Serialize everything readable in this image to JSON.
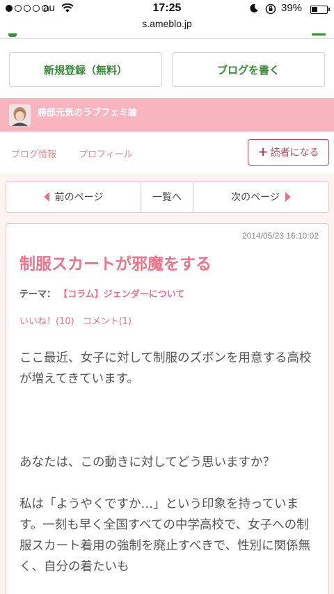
{
  "status_bar": {
    "carrier": "au",
    "time": "17:25",
    "battery_percent": "39%",
    "battery_level": 0.39
  },
  "browser": {
    "url": "s.ameblo.jp"
  },
  "top_buttons": {
    "register": "新規登録（無料）",
    "write_blog": "ブログを書く"
  },
  "blog": {
    "title": "勝部元気のラブフェミ論"
  },
  "nav": {
    "blog_info": "ブログ情報",
    "profile": "プロフィール",
    "reader_button": "読者になる"
  },
  "pager": {
    "prev": "前のページ",
    "list": "一覧へ",
    "next": "次のページ"
  },
  "article": {
    "timestamp": "2014/05/23 16:10:02",
    "title": "制服スカートが邪魔をする",
    "theme_label": "テーマ：",
    "theme": "【コラム】ジェンダーについて",
    "likes": "いいね！(10)",
    "comments": "コメント(1)",
    "paragraphs": [
      "ここ最近、女子に対して制服のズボンを用意する高校が増えてきています。",
      "あなたは、この動きに対してどう思いますか？",
      "私は「ようやくですか…」という印象を持っています。一刻も早く全国すべての中学高校で、女子への制服スカート着用の強制を廃止すべきで、性別に関係無く、自分の着たいも"
    ]
  },
  "colors": {
    "brand_green": "#3a8a3a",
    "header_pink": "#f9b5bf",
    "accent_pink": "#ec7389",
    "reader_red": "#b8445e"
  }
}
